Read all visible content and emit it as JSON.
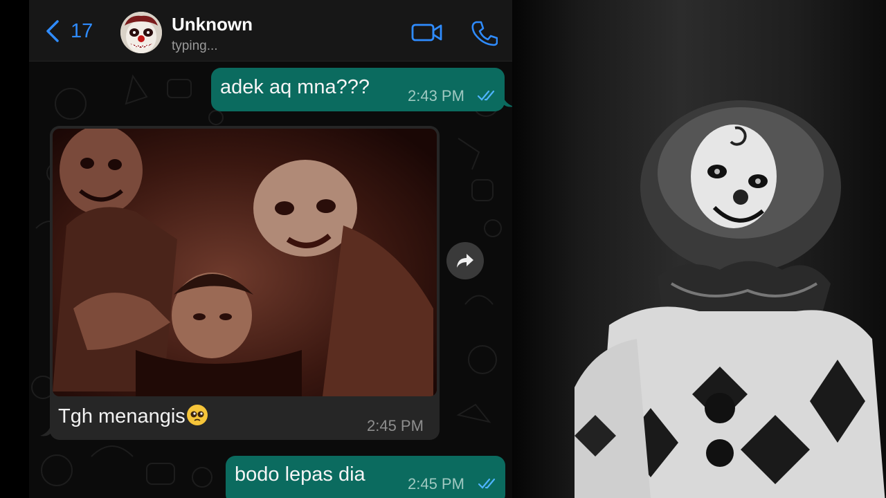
{
  "header": {
    "back_count": "17",
    "contact_name": "Unknown",
    "contact_status": "typing..."
  },
  "messages": [
    {
      "direction": "out",
      "text": "adek aq mna???",
      "time": "2:43 PM",
      "status": "read"
    },
    {
      "direction": "in",
      "type": "image",
      "caption": "Tgh menangis",
      "caption_emoji": "pleading-face",
      "time": "2:45 PM"
    },
    {
      "direction": "out",
      "text": "bodo lepas dia",
      "time": "2:45 PM",
      "status": "read"
    }
  ],
  "colors": {
    "accent": "#2f8cff",
    "outgoing_bubble": "#0b6b5f",
    "incoming_bubble": "#262626",
    "read_ticks": "#4fb4ff"
  },
  "icons": {
    "back": "chevron-left-icon",
    "video": "video-camera-icon",
    "call": "phone-icon",
    "forward": "forward-arrow-icon"
  }
}
